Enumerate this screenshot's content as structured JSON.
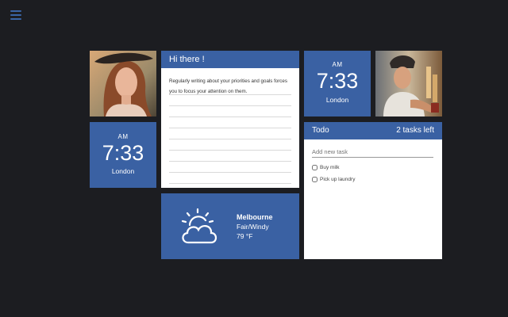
{
  "menu": {
    "icon": "hamburger-menu-icon"
  },
  "clocks": [
    {
      "ampm": "AM",
      "time": "7:33",
      "city": "London"
    },
    {
      "ampm": "AM",
      "time": "7:33",
      "city": "London"
    }
  ],
  "note": {
    "title": "Hi there !",
    "text": "Regularly writing about your priorities and goals forces you to focus your attention on them."
  },
  "todo": {
    "title": "Todo",
    "count": "2 tasks left",
    "placeholder": "Add new task",
    "items": [
      {
        "label": "Buy milk",
        "done": false
      },
      {
        "label": "Pick up laundry",
        "done": false
      }
    ]
  },
  "weather": {
    "icon": "partly-cloudy-icon",
    "city": "Melbourne",
    "condition": "Fair/Windy",
    "temperature": "79 °F"
  },
  "colors": {
    "background": "#1c1d21",
    "accent": "#3a61a3",
    "card": "#ffffff"
  }
}
